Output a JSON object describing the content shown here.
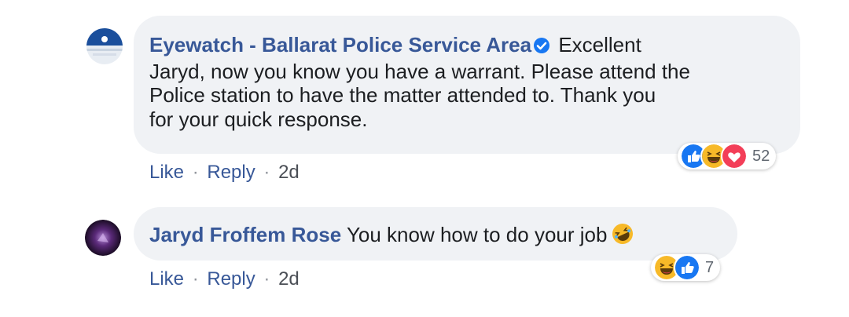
{
  "comments": [
    {
      "author": "Eyewatch - Ballarat Police Service Area",
      "verified": true,
      "text_lines": [
        "Excellent",
        "Jaryd, now you know you have a warrant. Please attend the",
        "Police station to have the matter attended to. Thank you",
        "for your quick response."
      ],
      "actions": {
        "like": "Like",
        "reply": "Reply",
        "sep": "·",
        "time": "2d"
      },
      "reactions": {
        "icons": [
          "like-icon",
          "haha-icon",
          "love-icon"
        ],
        "count": "52"
      },
      "avatar_icon": "police-logo-icon"
    },
    {
      "author": "Jaryd Froffem Rose",
      "text": "You know how to do your job",
      "inline_emoji": "rolling-laughing-emoji",
      "actions": {
        "like": "Like",
        "reply": "Reply",
        "sep": "·",
        "time": "2d"
      },
      "reactions": {
        "icons": [
          "haha-icon",
          "like-icon"
        ],
        "count": "7"
      },
      "avatar_icon": "user-avatar"
    }
  ],
  "colors": {
    "author": "#385898",
    "bubble": "#f0f2f5",
    "text": "#1c1e21",
    "like_blue": "#1877f2",
    "love_red": "#f33e58",
    "haha_yellow": "#f7b928"
  }
}
